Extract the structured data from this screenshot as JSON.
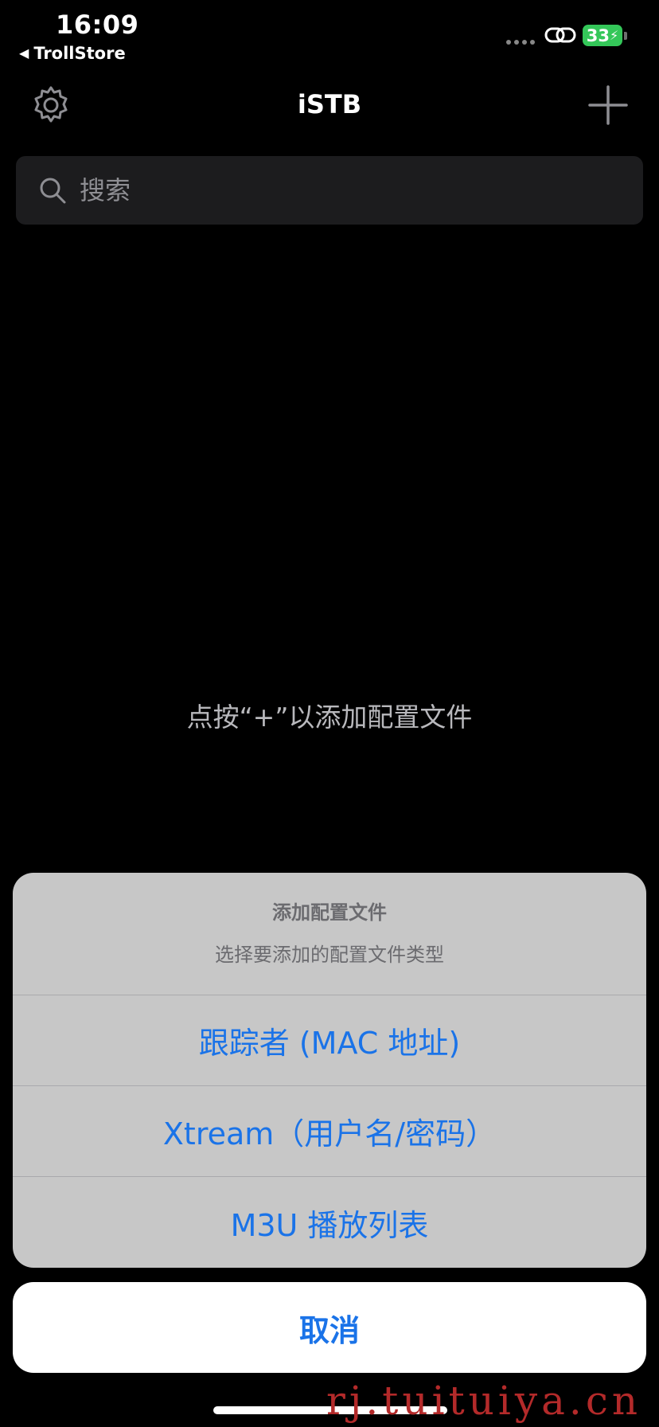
{
  "status_bar": {
    "time": "16:09",
    "back_app": "TrollStore",
    "battery": "33"
  },
  "nav": {
    "title": "iSTB"
  },
  "search": {
    "placeholder": "搜索"
  },
  "empty_hint": "点按“+”以添加配置文件",
  "action_sheet": {
    "title": "添加配置文件",
    "message": "选择要添加的配置文件类型",
    "options": [
      "跟踪者 (MAC 地址)",
      "Xtream（用户名/密码）",
      "M3U 播放列表"
    ],
    "cancel": "取消"
  },
  "watermark": "rj.tuituiya.cn",
  "colors": {
    "accent": "#1a73e8",
    "battery": "#34c759",
    "sheet_bg": "#c7c7c7",
    "watermark": "#b32a2a"
  }
}
